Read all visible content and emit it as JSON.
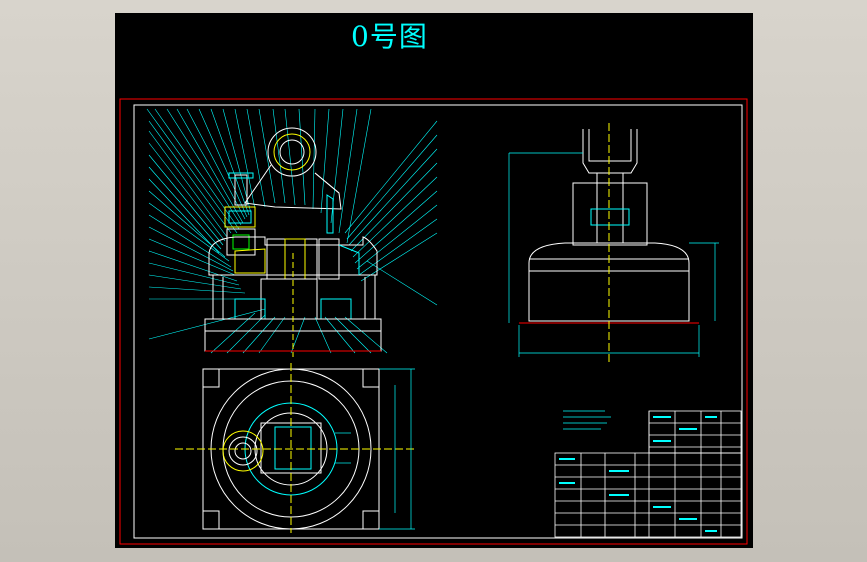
{
  "drawing": {
    "title": "0号图",
    "colors": {
      "background": "#000000",
      "frame_red": "#ff0000",
      "cyan": "#00ffff",
      "white": "#ffffff",
      "yellow": "#ffff00",
      "green": "#00ff00"
    }
  }
}
